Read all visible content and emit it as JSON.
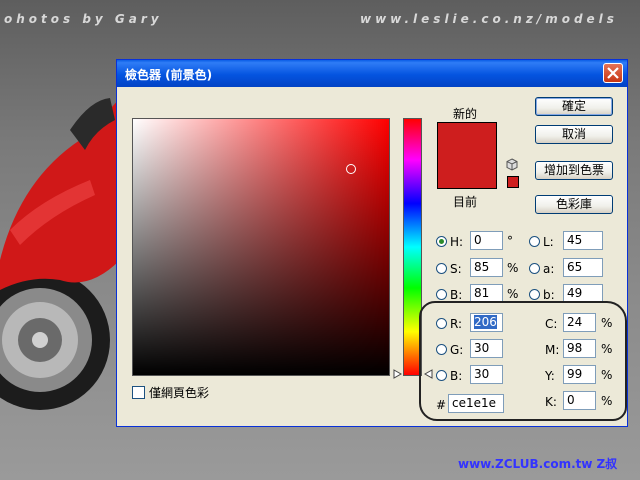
{
  "background": {
    "watermark_left": "ohotos by Gary",
    "watermark_right": "www.leslie.co.nz/models",
    "footer_link": "www.ZCLUB.com.tw",
    "footer_signature": "Z叔"
  },
  "dialog": {
    "title": "檢色器 (前景色)",
    "new_label": "新的",
    "current_label": "目前",
    "new_color": "#ce1e1e",
    "current_color": "#ce1e1e",
    "web_only_label": "僅網頁色彩",
    "buttons": {
      "ok": "確定",
      "cancel": "取消",
      "add_to_swatches": "增加到色票",
      "color_libraries": "色彩庫"
    },
    "hsb": {
      "h_label": "H:",
      "h_value": "0",
      "h_unit": "°",
      "s_label": "S:",
      "s_value": "85",
      "s_unit": "%",
      "b_label": "B:",
      "b_value": "81",
      "b_unit": "%"
    },
    "lab": {
      "l_label": "L:",
      "l_value": "45",
      "a_label": "a:",
      "a_value": "65",
      "b_label": "b:",
      "b_value": "49"
    },
    "rgb": {
      "r_label": "R:",
      "r_value": "206",
      "g_label": "G:",
      "g_value": "30",
      "b_label": "B:",
      "b_value": "30"
    },
    "cmyk": {
      "c_label": "C:",
      "c_value": "24",
      "c_unit": "%",
      "m_label": "M:",
      "m_value": "98",
      "m_unit": "%",
      "y_label": "Y:",
      "y_value": "99",
      "y_unit": "%",
      "k_label": "K:",
      "k_value": "0",
      "k_unit": "%"
    },
    "hex_label": "#",
    "hex_value": "ce1e1e",
    "selected_mode": "H"
  }
}
